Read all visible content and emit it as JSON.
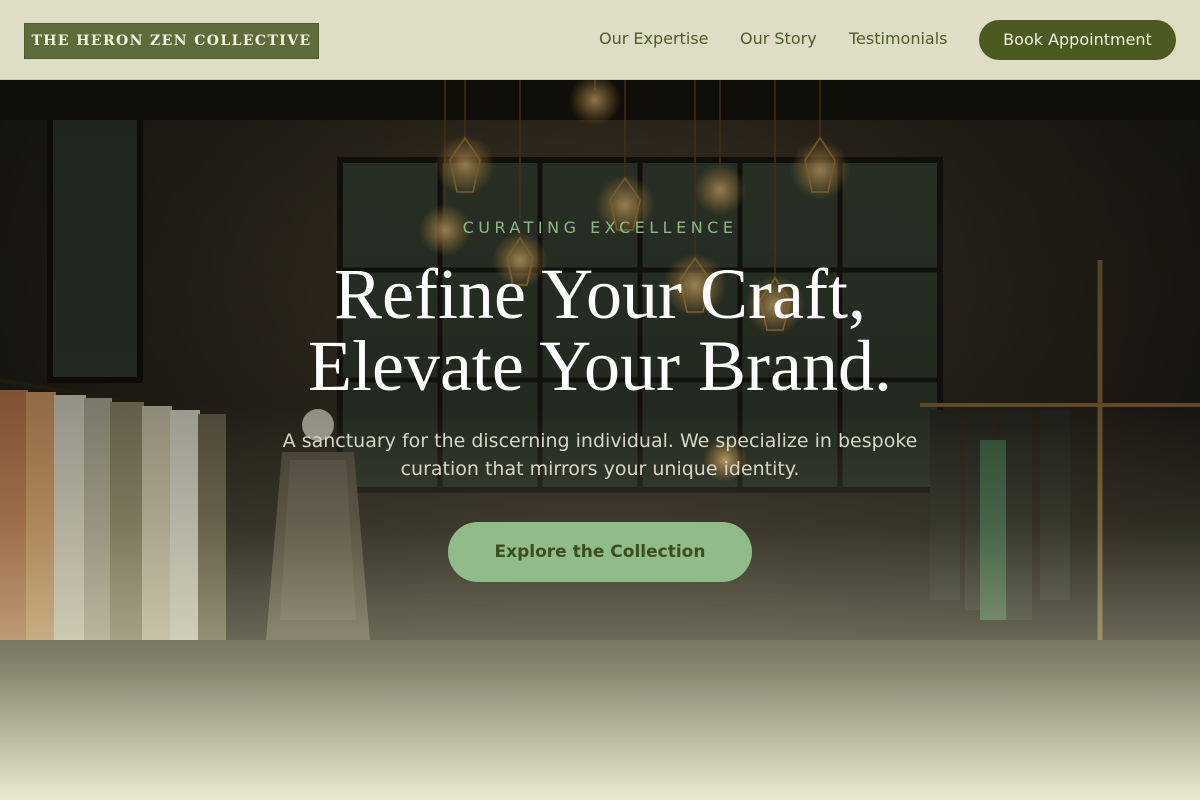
{
  "header": {
    "brand": "THE HERON ZEN COLLECTIVE",
    "nav": [
      {
        "label": "Our Expertise"
      },
      {
        "label": "Our Story"
      },
      {
        "label": "Testimonials"
      }
    ],
    "cta_label": "Book Appointment"
  },
  "hero": {
    "eyebrow": "CURATING EXCELLENCE",
    "headline_line1": "Refine Your Craft,",
    "headline_line2": "Elevate Your Brand.",
    "subtitle": "A sanctuary for the discerning individual. We specialize in bespoke curation that mirrors your unique identity.",
    "cta_label": "Explore the Collection"
  },
  "colors": {
    "header_bg": "#deddc6",
    "brand_bg": "#5f6b3a",
    "nav_text": "#4e5b2b",
    "book_button_bg": "#4c5a21",
    "eyebrow_text": "#8fb886",
    "cta_bg": "#8fbc88",
    "cta_text": "#3e4d1e"
  }
}
